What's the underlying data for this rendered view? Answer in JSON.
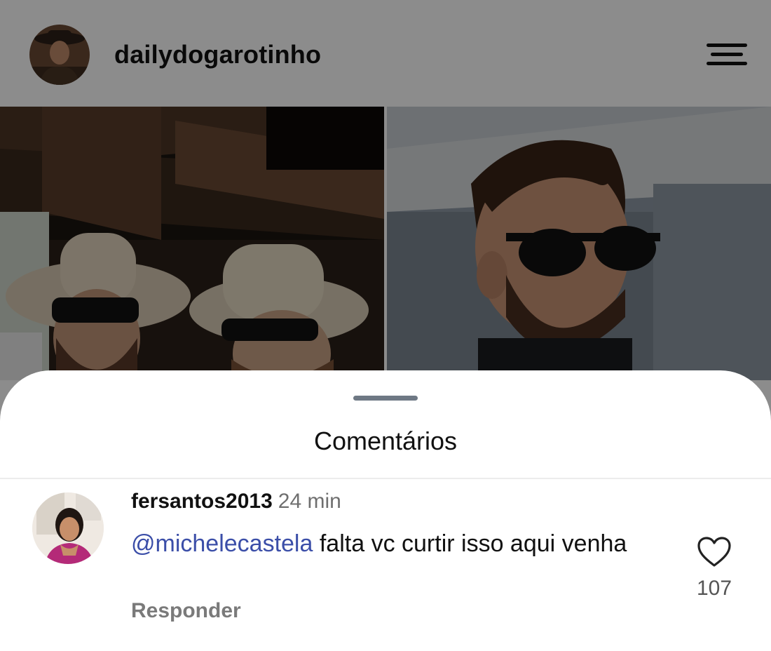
{
  "profile": {
    "username": "dailydogarotinho",
    "avatar_icon": "profile-avatar",
    "menu_icon": "hamburger-menu-icon"
  },
  "sheet": {
    "title": "Comentários"
  },
  "comments": [
    {
      "username": "fersantos2013",
      "time": "24 min",
      "mention": "@michelecastela",
      "text": "falta vc curtir isso aqui venha",
      "reply_label": "Responder",
      "like_icon": "heart-outline-icon",
      "likes": "107"
    }
  ],
  "colors": {
    "mention": "#3b4ea8",
    "overlay": "rgba(0,0,0,0.45)"
  }
}
